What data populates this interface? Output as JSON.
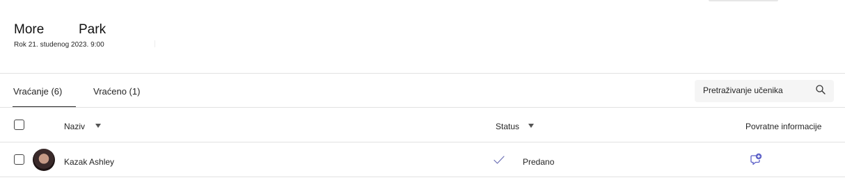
{
  "assignment": {
    "title_part1": "More",
    "title_part2": "Park",
    "due": "Rok 21. studenog 2023. 9:00"
  },
  "tabs": [
    {
      "label": "Vraćanje (6)",
      "selected": true
    },
    {
      "label": "Vraćeno (1)",
      "selected": false
    }
  ],
  "search": {
    "placeholder": "Pretraživanje učenika",
    "icon": "search-icon"
  },
  "table": {
    "columns": {
      "name": "Naziv",
      "status": "Status",
      "feedback": "Povratne informacije"
    },
    "rows": [
      {
        "name": "Kazak Ashley",
        "status": "Predano",
        "status_icon": "checkmark-icon",
        "feedback_icon": "add-feedback-icon"
      }
    ]
  },
  "colors": {
    "accent": "#5b5fc7",
    "check": "#6b6fb4",
    "divider": "#e1e1e1",
    "search_bg": "#f5f5f5"
  }
}
